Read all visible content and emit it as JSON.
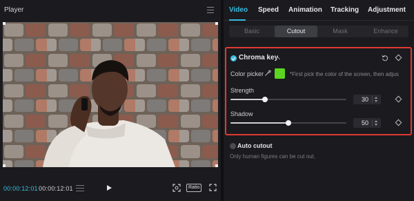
{
  "player": {
    "title": "Player",
    "current_time": "00:00:12:01",
    "total_time": "00:00:12:01",
    "ratio_label": "Ratio"
  },
  "inspector": {
    "tabs": [
      {
        "label": "Video",
        "active": true
      },
      {
        "label": "Speed",
        "active": false
      },
      {
        "label": "Animation",
        "active": false
      },
      {
        "label": "Tracking",
        "active": false
      },
      {
        "label": "Adjustment",
        "active": false
      }
    ],
    "subtabs": [
      {
        "label": "Basic",
        "active": false
      },
      {
        "label": "Cutout",
        "active": true
      },
      {
        "label": "Mask",
        "active": false
      },
      {
        "label": "Enhance",
        "active": false
      }
    ],
    "chroma_key": {
      "title": "Chroma key",
      "enabled": true,
      "color_picker_label": "Color picker",
      "picked_color": "#5bd51f",
      "hint": "*First pick the color of the screen, then adjus...",
      "strength": {
        "label": "Strength",
        "value": "30",
        "fraction": 0.3
      },
      "shadow": {
        "label": "Shadow",
        "value": "50",
        "fraction": 0.5
      }
    },
    "auto_cutout": {
      "title": "Auto cutout",
      "enabled": false,
      "note": "Only human figures can be cut out."
    }
  },
  "colors": {
    "accent": "#38bde0",
    "highlight_border": "#e03a32",
    "panel_bg": "#1b1b1f"
  }
}
